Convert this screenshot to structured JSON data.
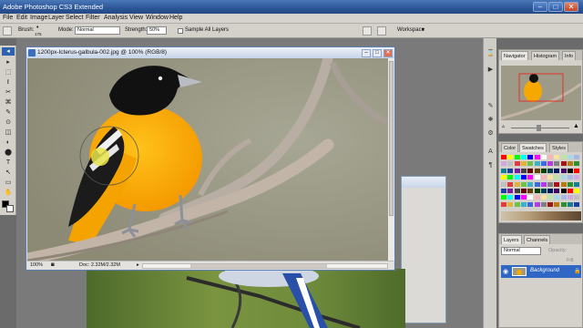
{
  "app": {
    "title": "Adobe Photoshop CS3 Extended",
    "window_buttons": [
      "–",
      "□",
      "✕"
    ]
  },
  "menu": [
    "File",
    "Edit",
    "Image",
    "Layer",
    "Select",
    "Filter",
    "Analysis",
    "View",
    "Window",
    "Help"
  ],
  "options": {
    "brush_label": "Brush:",
    "brush_size": "175",
    "mode_label": "Mode:",
    "mode_value": "Normal",
    "strength_label": "Strength:",
    "strength_value": "50%",
    "sample_all_layers": "Sample All Layers",
    "workspace_label": "Workspace"
  },
  "document": {
    "title": "1200px-Icterus-galbula-002.jpg @ 100% (RGB/8)",
    "zoom": "100%",
    "doc_info": "Doc: 2.32M/2.32M"
  },
  "navigator": {
    "tabs": [
      "Navigator",
      "Histogram",
      "Info"
    ]
  },
  "color_panel": {
    "tabs": [
      "Color",
      "Swatches",
      "Styles"
    ],
    "swatch_colors": [
      "#ff0000",
      "#ffff00",
      "#00ff00",
      "#00ffff",
      "#0000ff",
      "#ff00ff",
      "#ffffff",
      "#f2b7b7",
      "#f7e3a0",
      "#bfe3a7",
      "#a7d8e3",
      "#a9b7e6",
      "#d4a7e3",
      "#c0c0c0",
      "#e33b3b",
      "#e3b23b",
      "#6cc24a",
      "#3bb2c9",
      "#3b6ae3",
      "#b23be3",
      "#808080",
      "#a31515",
      "#b37a16",
      "#2f8f2f",
      "#167e8f",
      "#1a3fa3",
      "#7a1aa3",
      "#404040",
      "#600000",
      "#604000",
      "#004000",
      "#004050",
      "#001a60",
      "#400060",
      "#000000"
    ]
  },
  "layers": {
    "tabs": [
      "Layers",
      "Channels"
    ],
    "blend_mode": "Normal",
    "opacity_label": "Opacity:",
    "fill_label": "Fill:",
    "layer_name": "Background"
  },
  "tools": [
    "▸",
    "⬚",
    "ℓ",
    "✂",
    "⌘",
    "✎",
    "⊙",
    "◫",
    "◐",
    "⬤",
    "T",
    "↖",
    "▭",
    "✋",
    "🔍"
  ]
}
